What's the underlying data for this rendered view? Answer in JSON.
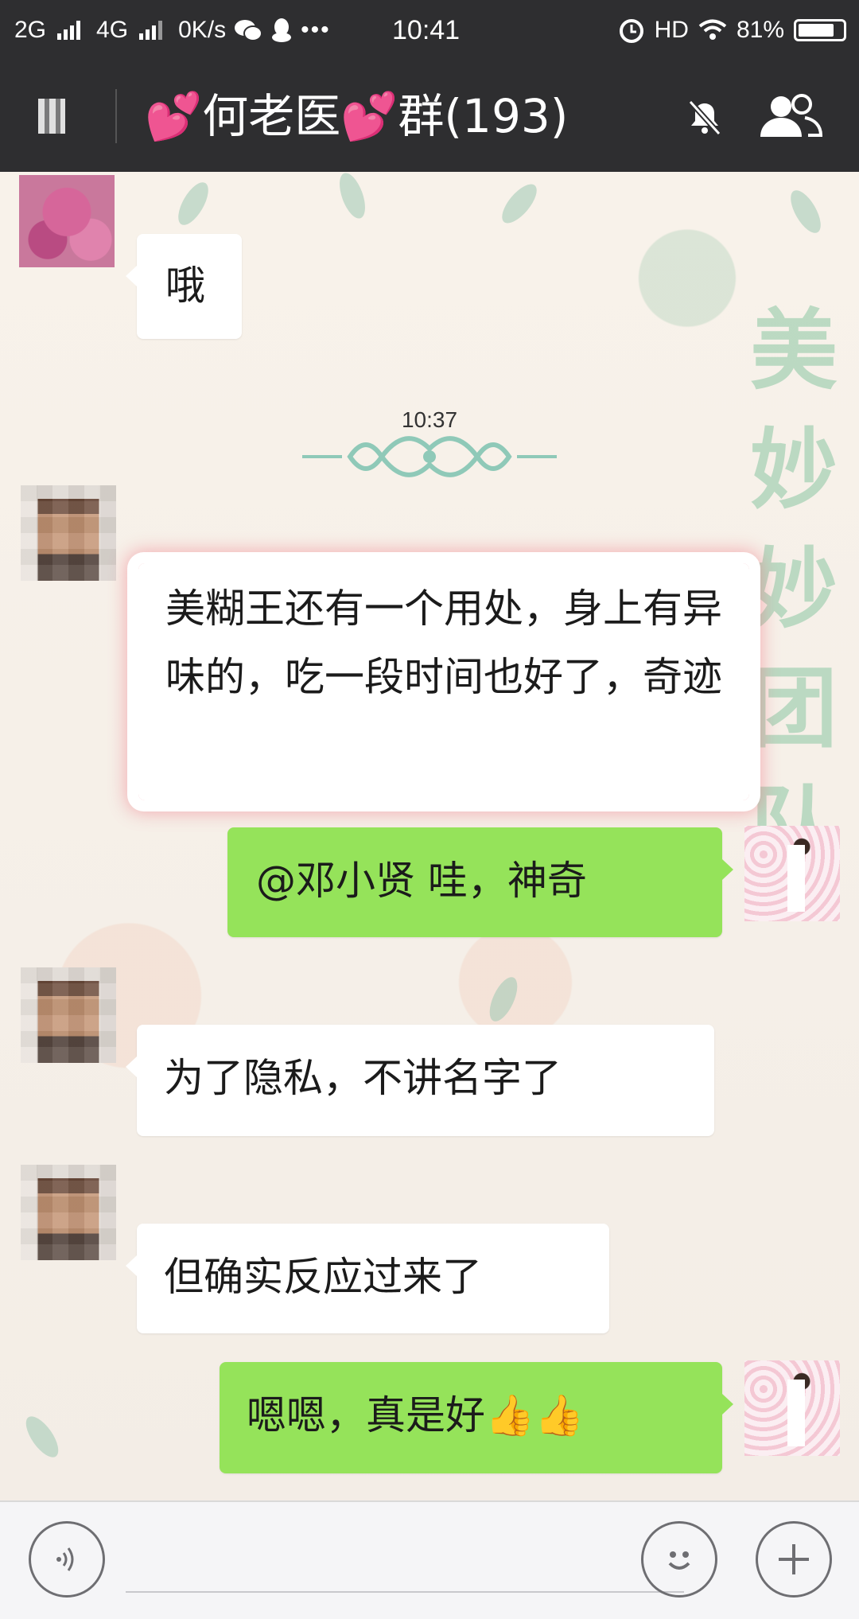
{
  "status_bar": {
    "network_2g": "2G",
    "network_4g": "4G",
    "speed": "0K/s",
    "time": "10:41",
    "hd": "HD",
    "battery_percent": "81%",
    "battery_level": 0.81
  },
  "header": {
    "title": "💕何老医💕群(193)"
  },
  "chat": {
    "decoration_text": [
      "美",
      "妙",
      "妙",
      "团",
      "队"
    ],
    "timestamp": "10:37",
    "messages": [
      {
        "side": "left",
        "text": "哦"
      },
      {
        "side": "left",
        "text": "美糊王还有一个用处，身上有异味的，吃一段时间也好了，奇迹"
      },
      {
        "side": "right",
        "text": "@邓小贤  哇，神奇"
      },
      {
        "side": "left",
        "text": "为了隐私，不讲名字了"
      },
      {
        "side": "left",
        "text": "但确实反应过来了"
      },
      {
        "side": "right",
        "text": "嗯嗯，真是好👍👍"
      }
    ]
  },
  "colors": {
    "bar_bg": "#2e2e30",
    "bubble_green": "#95e35a",
    "highlight_border": "#f08c96"
  },
  "icons": {
    "voice": "voice-icon",
    "emoji": "emoji-icon",
    "plus": "plus-icon"
  }
}
